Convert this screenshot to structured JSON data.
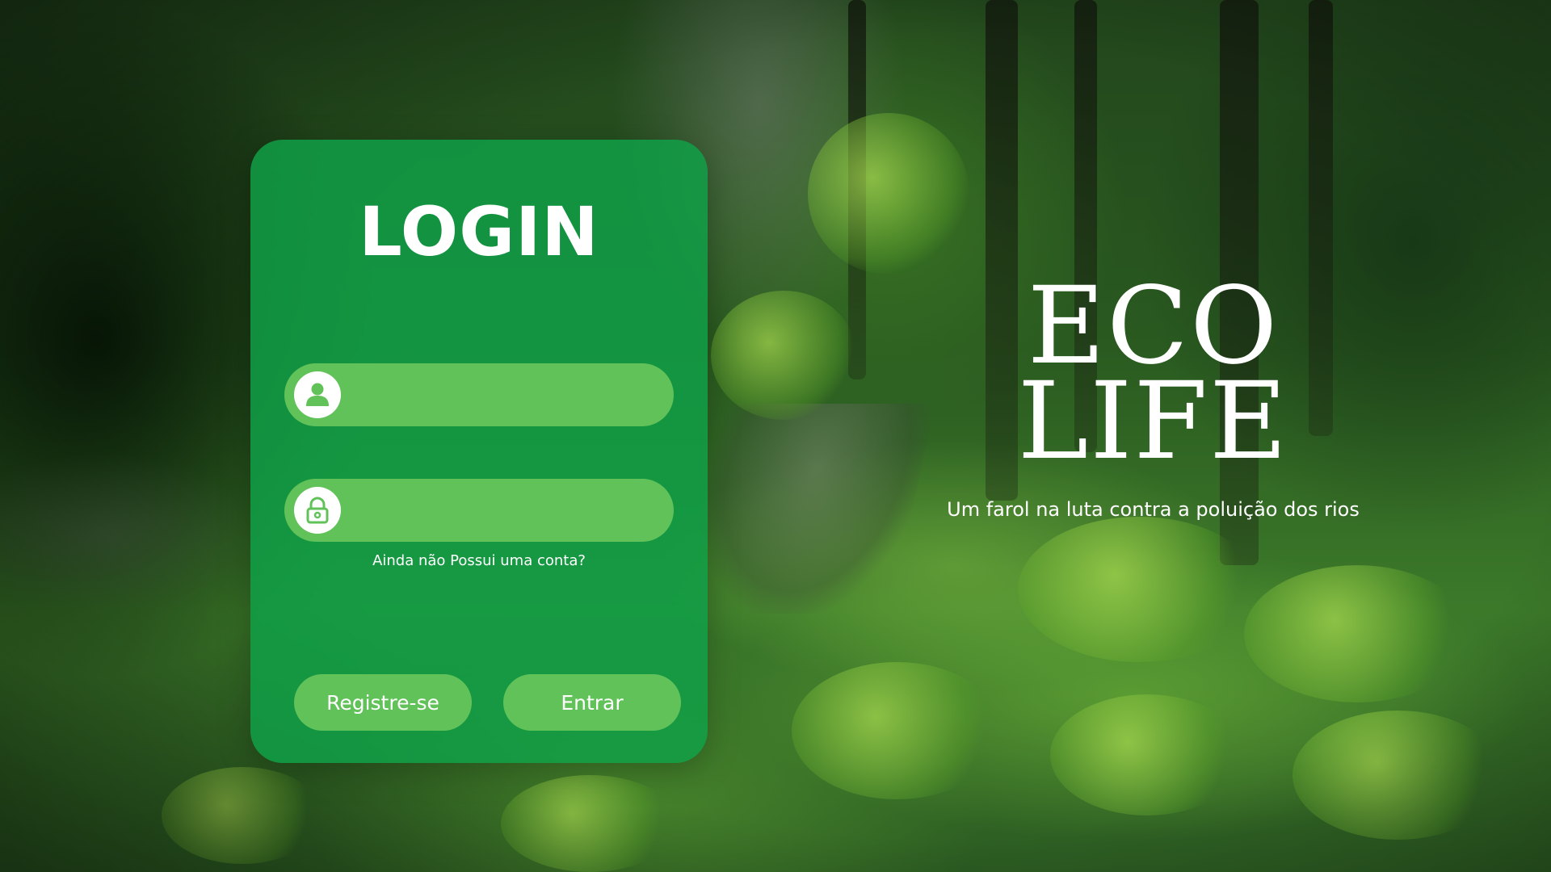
{
  "login": {
    "title": "LOGIN",
    "username": {
      "icon": "user-icon",
      "value": "",
      "placeholder": ""
    },
    "password": {
      "icon": "lock-icon",
      "value": "",
      "placeholder": ""
    },
    "signup_hint": "Ainda não Possui uma conta?",
    "register_label": "Registre-se",
    "enter_label": "Entrar"
  },
  "brand": {
    "line1": "ECO",
    "line2": "LIFE",
    "tagline": "Um farol na luta contra a poluição dos rios"
  },
  "colors": {
    "card": "#10a048",
    "field": "#62c25a",
    "text": "#ffffff"
  }
}
